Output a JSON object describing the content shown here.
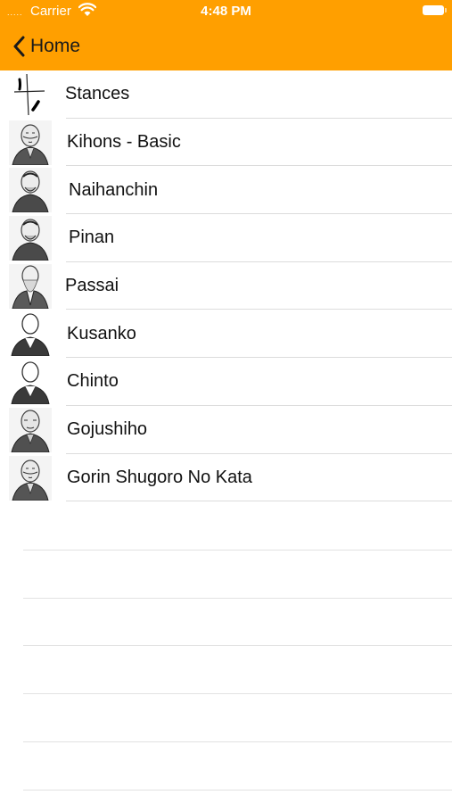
{
  "status_bar": {
    "signal": ".....",
    "carrier": "Carrier",
    "time": "4:48 PM"
  },
  "nav": {
    "back_label": "Home",
    "accent_color": "#FF9F00"
  },
  "items": [
    {
      "label": "Stances",
      "icon": "calligraphy-icon"
    },
    {
      "label": "Kihons - Basic",
      "icon": "master-portrait"
    },
    {
      "label": "Naihanchin",
      "icon": "master-portrait"
    },
    {
      "label": "Pinan",
      "icon": "master-portrait"
    },
    {
      "label": "Passai",
      "icon": "master-portrait"
    },
    {
      "label": "Kusanko",
      "icon": "silhouette-portrait"
    },
    {
      "label": "Chinto",
      "icon": "silhouette-portrait"
    },
    {
      "label": "Gojushiho",
      "icon": "master-portrait"
    },
    {
      "label": "Gorin Shugoro No Kata",
      "icon": "master-portrait"
    }
  ]
}
